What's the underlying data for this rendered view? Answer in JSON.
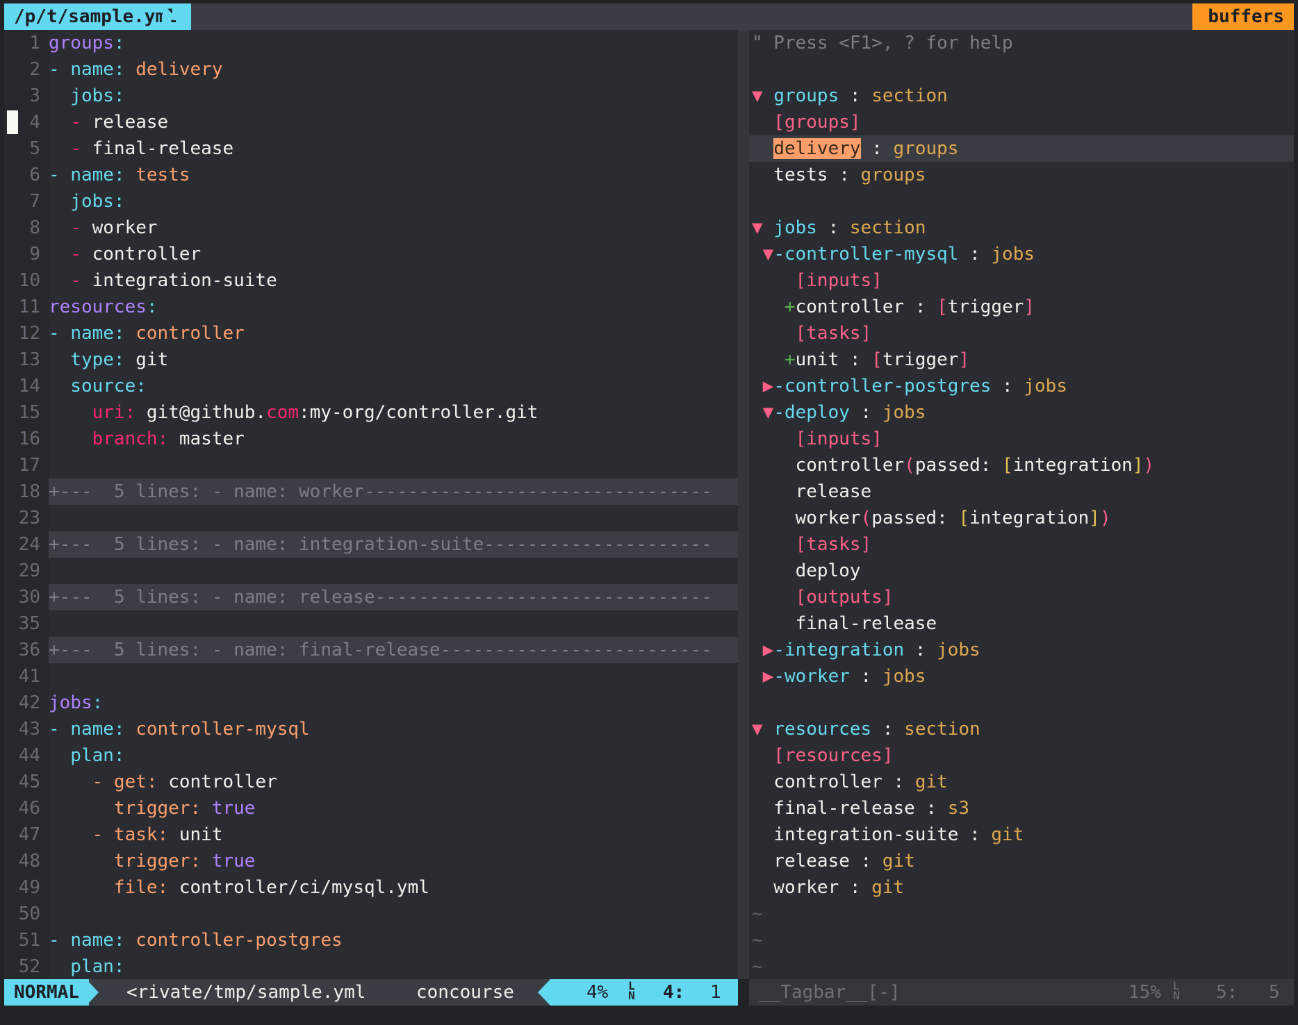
{
  "tabline": {
    "path": "/p/t/sample.yml",
    "buffers_label": "buffers"
  },
  "editor": {
    "line_numbers": [
      "1",
      "2",
      "3",
      "4",
      "5",
      "6",
      "7",
      "8",
      "9",
      "10",
      "11",
      "12",
      "13",
      "14",
      "15",
      "16",
      "17",
      "18",
      "23",
      "24",
      "29",
      "30",
      "35",
      "36",
      "41",
      "42",
      "43",
      "44",
      "45",
      "46",
      "47",
      "48",
      "49",
      "50",
      "51",
      "52"
    ],
    "lines": [
      [
        {
          "t": "groups",
          "c": "purple"
        },
        {
          "t": ":",
          "c": "cyan"
        }
      ],
      [
        {
          "t": "- ",
          "c": "cyan"
        },
        {
          "t": "name",
          "c": "cyan"
        },
        {
          "t": ": ",
          "c": "cyan"
        },
        {
          "t": "delivery",
          "c": "orange"
        }
      ],
      [
        {
          "t": "  jobs",
          "c": "cyan"
        },
        {
          "t": ":",
          "c": "cyan"
        }
      ],
      [
        {
          "t": "  - ",
          "c": "red"
        },
        {
          "t": "release",
          "c": "white"
        }
      ],
      [
        {
          "t": "  - ",
          "c": "red"
        },
        {
          "t": "final-release",
          "c": "white"
        }
      ],
      [
        {
          "t": "- ",
          "c": "cyan"
        },
        {
          "t": "name",
          "c": "cyan"
        },
        {
          "t": ": ",
          "c": "cyan"
        },
        {
          "t": "tests",
          "c": "orange"
        }
      ],
      [
        {
          "t": "  jobs",
          "c": "cyan"
        },
        {
          "t": ":",
          "c": "cyan"
        }
      ],
      [
        {
          "t": "  - ",
          "c": "red"
        },
        {
          "t": "worker",
          "c": "white"
        }
      ],
      [
        {
          "t": "  - ",
          "c": "red"
        },
        {
          "t": "controller",
          "c": "white"
        }
      ],
      [
        {
          "t": "  - ",
          "c": "red"
        },
        {
          "t": "integration-suite",
          "c": "white"
        }
      ],
      [
        {
          "t": "resources",
          "c": "purple"
        },
        {
          "t": ":",
          "c": "cyan"
        }
      ],
      [
        {
          "t": "- ",
          "c": "cyan"
        },
        {
          "t": "name",
          "c": "cyan"
        },
        {
          "t": ": ",
          "c": "cyan"
        },
        {
          "t": "controller",
          "c": "orange"
        }
      ],
      [
        {
          "t": "  type",
          "c": "cyan"
        },
        {
          "t": ": ",
          "c": "cyan"
        },
        {
          "t": "git",
          "c": "white"
        }
      ],
      [
        {
          "t": "  source",
          "c": "cyan"
        },
        {
          "t": ":",
          "c": "cyan"
        }
      ],
      [
        {
          "t": "    uri",
          "c": "red"
        },
        {
          "t": ": ",
          "c": "red"
        },
        {
          "t": "git@github.",
          "c": "white"
        },
        {
          "t": "com",
          "c": "red"
        },
        {
          "t": ":my-org/controller.git",
          "c": "white"
        }
      ],
      [
        {
          "t": "    branch",
          "c": "red"
        },
        {
          "t": ": ",
          "c": "red"
        },
        {
          "t": "master",
          "c": "white"
        }
      ],
      [],
      [
        {
          "t": "+---  5 lines: - name: worker--------------------------------",
          "c": "gray"
        }
      ],
      [],
      [
        {
          "t": "+---  5 lines: - name: integration-suite---------------------",
          "c": "gray"
        }
      ],
      [],
      [
        {
          "t": "+---  5 lines: - name: release-------------------------------",
          "c": "gray"
        }
      ],
      [],
      [
        {
          "t": "+---  5 lines: - name: final-release-------------------------",
          "c": "gray"
        }
      ],
      [],
      [
        {
          "t": "jobs",
          "c": "purple"
        },
        {
          "t": ":",
          "c": "cyan"
        }
      ],
      [
        {
          "t": "- ",
          "c": "cyan"
        },
        {
          "t": "name",
          "c": "cyan"
        },
        {
          "t": ": ",
          "c": "cyan"
        },
        {
          "t": "controller-mysql",
          "c": "orange"
        }
      ],
      [
        {
          "t": "  plan",
          "c": "cyan"
        },
        {
          "t": ":",
          "c": "cyan"
        }
      ],
      [
        {
          "t": "    - ",
          "c": "orange"
        },
        {
          "t": "get",
          "c": "orange"
        },
        {
          "t": ": ",
          "c": "orange"
        },
        {
          "t": "controller",
          "c": "white"
        }
      ],
      [
        {
          "t": "      trigger",
          "c": "orange"
        },
        {
          "t": ": ",
          "c": "orange"
        },
        {
          "t": "true",
          "c": "purple"
        }
      ],
      [
        {
          "t": "    - ",
          "c": "orange"
        },
        {
          "t": "task",
          "c": "orange"
        },
        {
          "t": ": ",
          "c": "orange"
        },
        {
          "t": "unit",
          "c": "white"
        }
      ],
      [
        {
          "t": "      trigger",
          "c": "orange"
        },
        {
          "t": ": ",
          "c": "orange"
        },
        {
          "t": "true",
          "c": "purple"
        }
      ],
      [
        {
          "t": "      file",
          "c": "orange"
        },
        {
          "t": ": ",
          "c": "orange"
        },
        {
          "t": "controller/ci/mysql.yml",
          "c": "white"
        }
      ],
      [],
      [
        {
          "t": "- ",
          "c": "cyan"
        },
        {
          "t": "name",
          "c": "cyan"
        },
        {
          "t": ": ",
          "c": "cyan"
        },
        {
          "t": "controller-postgres",
          "c": "orange"
        }
      ],
      [
        {
          "t": "  plan",
          "c": "cyan"
        },
        {
          "t": ":",
          "c": "cyan"
        }
      ]
    ]
  },
  "tagbar": {
    "lines": [
      [
        {
          "t": "\" Press <F1>, ? for help",
          "c": "gray"
        }
      ],
      [],
      [
        {
          "t": "▼ ",
          "c": "pink"
        },
        {
          "t": "groups",
          "c": "cyan"
        },
        {
          "t": " : ",
          "c": "white"
        },
        {
          "t": "section",
          "c": "gold"
        }
      ],
      [
        {
          "t": "  [groups]",
          "c": "pink"
        }
      ],
      [
        {
          "t": "  ",
          "c": "white"
        },
        {
          "t": "delivery",
          "c": "hl"
        },
        {
          "t": " : ",
          "c": "white"
        },
        {
          "t": "groups",
          "c": "gold"
        }
      ],
      [
        {
          "t": "  tests",
          "c": "white"
        },
        {
          "t": " : ",
          "c": "white"
        },
        {
          "t": "groups",
          "c": "gold"
        }
      ],
      [],
      [
        {
          "t": "▼ ",
          "c": "pink"
        },
        {
          "t": "jobs",
          "c": "cyan"
        },
        {
          "t": " : ",
          "c": "white"
        },
        {
          "t": "section",
          "c": "gold"
        }
      ],
      [
        {
          "t": " ▼",
          "c": "pink"
        },
        {
          "t": "-controller-mysql",
          "c": "cyan"
        },
        {
          "t": " : ",
          "c": "white"
        },
        {
          "t": "jobs",
          "c": "gold"
        }
      ],
      [
        {
          "t": "    [inputs]",
          "c": "pink"
        }
      ],
      [
        {
          "t": "   +",
          "c": "green"
        },
        {
          "t": "controller",
          "c": "white"
        },
        {
          "t": " : ",
          "c": "white"
        },
        {
          "t": "[",
          "c": "pink"
        },
        {
          "t": "trigger",
          "c": "white"
        },
        {
          "t": "]",
          "c": "pink"
        }
      ],
      [
        {
          "t": "    [tasks]",
          "c": "pink"
        }
      ],
      [
        {
          "t": "   +",
          "c": "green"
        },
        {
          "t": "unit",
          "c": "white"
        },
        {
          "t": " : ",
          "c": "white"
        },
        {
          "t": "[",
          "c": "pink"
        },
        {
          "t": "trigger",
          "c": "white"
        },
        {
          "t": "]",
          "c": "pink"
        }
      ],
      [
        {
          "t": " ▶",
          "c": "pink"
        },
        {
          "t": "-controller-postgres",
          "c": "cyan"
        },
        {
          "t": " : ",
          "c": "white"
        },
        {
          "t": "jobs",
          "c": "gold"
        }
      ],
      [
        {
          "t": " ▼",
          "c": "pink"
        },
        {
          "t": "-deploy",
          "c": "cyan"
        },
        {
          "t": " : ",
          "c": "white"
        },
        {
          "t": "jobs",
          "c": "gold"
        }
      ],
      [
        {
          "t": "    [inputs]",
          "c": "pink"
        }
      ],
      [
        {
          "t": "    controller",
          "c": "white"
        },
        {
          "t": "(",
          "c": "pink"
        },
        {
          "t": "passed: ",
          "c": "white"
        },
        {
          "t": "[",
          "c": "yellow"
        },
        {
          "t": "integration",
          "c": "white"
        },
        {
          "t": "]",
          "c": "yellow"
        },
        {
          "t": ")",
          "c": "pink"
        }
      ],
      [
        {
          "t": "    release",
          "c": "white"
        }
      ],
      [
        {
          "t": "    worker",
          "c": "white"
        },
        {
          "t": "(",
          "c": "pink"
        },
        {
          "t": "passed: ",
          "c": "white"
        },
        {
          "t": "[",
          "c": "yellow"
        },
        {
          "t": "integration",
          "c": "white"
        },
        {
          "t": "]",
          "c": "yellow"
        },
        {
          "t": ")",
          "c": "pink"
        }
      ],
      [
        {
          "t": "    [tasks]",
          "c": "pink"
        }
      ],
      [
        {
          "t": "    deploy",
          "c": "white"
        }
      ],
      [
        {
          "t": "    [outputs]",
          "c": "pink"
        }
      ],
      [
        {
          "t": "    final-release",
          "c": "white"
        }
      ],
      [
        {
          "t": " ▶",
          "c": "pink"
        },
        {
          "t": "-integration",
          "c": "cyan"
        },
        {
          "t": " : ",
          "c": "white"
        },
        {
          "t": "jobs",
          "c": "gold"
        }
      ],
      [
        {
          "t": " ▶",
          "c": "pink"
        },
        {
          "t": "-worker",
          "c": "cyan"
        },
        {
          "t": " : ",
          "c": "white"
        },
        {
          "t": "jobs",
          "c": "gold"
        }
      ],
      [],
      [
        {
          "t": "▼ ",
          "c": "pink"
        },
        {
          "t": "resources",
          "c": "cyan"
        },
        {
          "t": " : ",
          "c": "white"
        },
        {
          "t": "section",
          "c": "gold"
        }
      ],
      [
        {
          "t": "  [resources]",
          "c": "pink"
        }
      ],
      [
        {
          "t": "  controller",
          "c": "white"
        },
        {
          "t": " : ",
          "c": "white"
        },
        {
          "t": "git",
          "c": "gold"
        }
      ],
      [
        {
          "t": "  final-release",
          "c": "white"
        },
        {
          "t": " : ",
          "c": "white"
        },
        {
          "t": "s3",
          "c": "gold"
        }
      ],
      [
        {
          "t": "  integration-suite",
          "c": "white"
        },
        {
          "t": " : ",
          "c": "white"
        },
        {
          "t": "git",
          "c": "gold"
        }
      ],
      [
        {
          "t": "  release",
          "c": "white"
        },
        {
          "t": " : ",
          "c": "white"
        },
        {
          "t": "git",
          "c": "gold"
        }
      ],
      [
        {
          "t": "  worker",
          "c": "white"
        },
        {
          "t": " : ",
          "c": "white"
        },
        {
          "t": "git",
          "c": "gold"
        }
      ],
      [
        {
          "t": "~",
          "c": "dim"
        }
      ],
      [
        {
          "t": "~",
          "c": "dim"
        }
      ],
      [
        {
          "t": "~",
          "c": "dim"
        }
      ]
    ]
  },
  "statusline": {
    "mode": "NORMAL",
    "file": "<rivate/tmp/sample.yml",
    "filetype": "concourse",
    "percent": "4%",
    "line_col": "4:",
    "col": "1",
    "ln_symbol_top": "L",
    "ln_symbol_bottom": "N"
  },
  "tagbar_status": {
    "name": "__Tagbar__[-]",
    "percent": "15%",
    "line_col": "5:",
    "col": "5",
    "ln_symbol_top": "L",
    "ln_symbol_bottom": "N"
  },
  "colors": {
    "accent_cyan": "#62d8f1",
    "accent_orange": "#fd9720",
    "background": "#2a2c31"
  }
}
